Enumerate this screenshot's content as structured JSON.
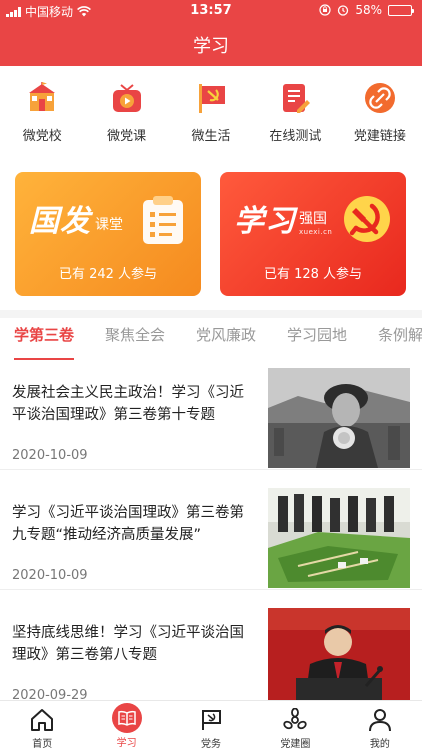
{
  "status_bar": {
    "carrier": "中国移动",
    "time": "13:57",
    "battery": "58%",
    "battery_level": 0.58
  },
  "header": {
    "title": "学习"
  },
  "quick_links": [
    {
      "label": "微党校",
      "icon": "party-school-icon"
    },
    {
      "label": "微党课",
      "icon": "video-lesson-icon"
    },
    {
      "label": "微生活",
      "icon": "party-flag-icon"
    },
    {
      "label": "在线测试",
      "icon": "online-test-icon"
    },
    {
      "label": "党建链接",
      "icon": "link-icon"
    }
  ],
  "cards": [
    {
      "brand_big": "国发",
      "brand_small": "课堂",
      "join_text": "已有 242 人参与"
    },
    {
      "brand_big": "学习",
      "brand_small": "强国",
      "brand_sub": "xuexi.cn",
      "join_text": "已有 128 人参与"
    }
  ],
  "tabs": [
    "学第三卷",
    "聚焦全会",
    "党风廉政",
    "学习园地",
    "条例解读"
  ],
  "active_tab": 0,
  "articles": [
    {
      "title": "发展社会主义民主政治！学习《习近平谈治国理政》第三卷第十专题",
      "date": "2020-10-09"
    },
    {
      "title": "学习《习近平谈治国理政》第三卷第九专题“推动经济高质量发展”",
      "date": "2020-10-09"
    },
    {
      "title": "坚持底线思维！学习《习近平谈治国理政》第三卷第八专题",
      "date": "2020-09-29"
    }
  ],
  "bottom_nav": [
    {
      "label": "首页",
      "icon": "home-icon"
    },
    {
      "label": "学习",
      "icon": "book-icon"
    },
    {
      "label": "党务",
      "icon": "flag-icon"
    },
    {
      "label": "党建圈",
      "icon": "circle-icon"
    },
    {
      "label": "我的",
      "icon": "user-icon"
    }
  ],
  "active_nav": 1,
  "colors": {
    "primary": "#e94545",
    "orange": "#f58a1f"
  }
}
